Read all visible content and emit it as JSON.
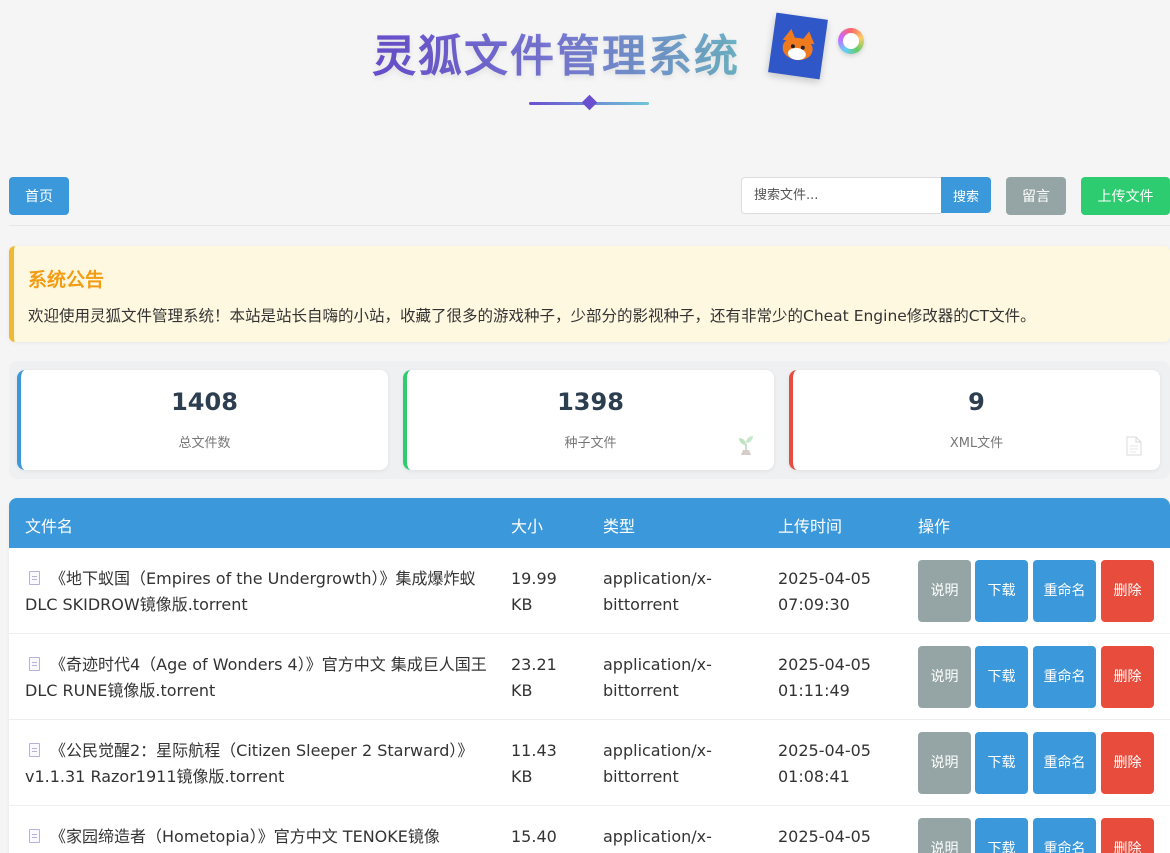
{
  "header": {
    "title": "灵狐文件管理系统"
  },
  "nav": {
    "home_label": "首页",
    "search_placeholder": "搜索文件...",
    "search_label": "搜索",
    "message_label": "留言",
    "upload_label": "上传文件"
  },
  "notice": {
    "title": "系统公告",
    "text": "欢迎使用灵狐文件管理系统！本站是站长自嗨的小站，收藏了很多的游戏种子，少部分的影视种子，还有非常少的Cheat Engine修改器的CT文件。"
  },
  "stats": [
    {
      "value": "1408",
      "label": "总文件数"
    },
    {
      "value": "1398",
      "label": "种子文件"
    },
    {
      "value": "9",
      "label": "XML文件"
    }
  ],
  "table": {
    "headers": {
      "name": "文件名",
      "size": "大小",
      "type": "类型",
      "time": "上传时间",
      "actions": "操作"
    },
    "action_labels": {
      "desc": "说明",
      "download": "下载",
      "rename": "重命名",
      "delete": "删除"
    },
    "rows": [
      {
        "name": "《地下蚁国（Empires of the Undergrowth）》集成爆炸蚁DLC SKIDROW镜像版.torrent",
        "size": "19.99 KB",
        "type": "application/x-bittorrent",
        "time": "2025-04-05 07:09:30"
      },
      {
        "name": "《奇迹时代4（Age of Wonders 4）》官方中文 集成巨人国王DLC RUNE镜像版.torrent",
        "size": "23.21 KB",
        "type": "application/x-bittorrent",
        "time": "2025-04-05 01:11:49"
      },
      {
        "name": "《公民觉醒2：星际航程（Citizen Sleeper 2 Starward）》v1.1.31 Razor1911镜像版.torrent",
        "size": "11.43 KB",
        "type": "application/x-bittorrent",
        "time": "2025-04-05 01:08:41"
      },
      {
        "name": "《家园缔造者（Hometopia）》官方中文 TENOKE镜像",
        "size": "15.40",
        "type": "application/x-",
        "time": "2025-04-05"
      }
    ]
  }
}
